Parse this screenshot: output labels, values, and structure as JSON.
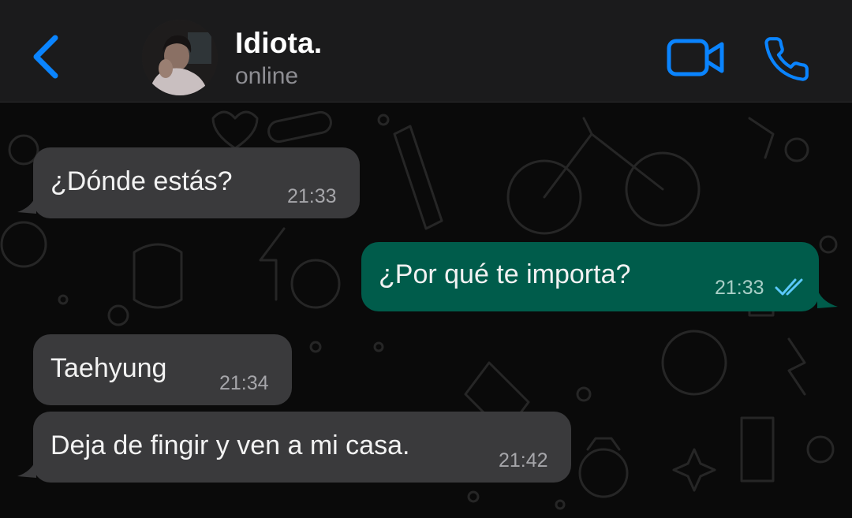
{
  "header": {
    "back_icon": "chevron-left-icon",
    "contact_name": "Idiota.",
    "status": "online",
    "video_icon": "video-camera-icon",
    "call_icon": "phone-icon",
    "accent_color": "#0a84ff"
  },
  "messages": [
    {
      "direction": "incoming",
      "text": "¿Dónde estás?",
      "time": "21:33"
    },
    {
      "direction": "outgoing",
      "text": "¿Por qué te importa?",
      "time": "21:33",
      "receipt": "read-double-check-icon"
    },
    {
      "direction": "incoming",
      "text": "Taehyung",
      "time": "21:34"
    },
    {
      "direction": "incoming",
      "text": "Deja de fingir y ven a mi casa.",
      "time": "21:42"
    }
  ],
  "colors": {
    "incoming_bubble": "#3a3a3c",
    "outgoing_bubble": "#005c4b",
    "header_bg": "#1b1b1c",
    "chat_bg": "#0a0a0a"
  }
}
